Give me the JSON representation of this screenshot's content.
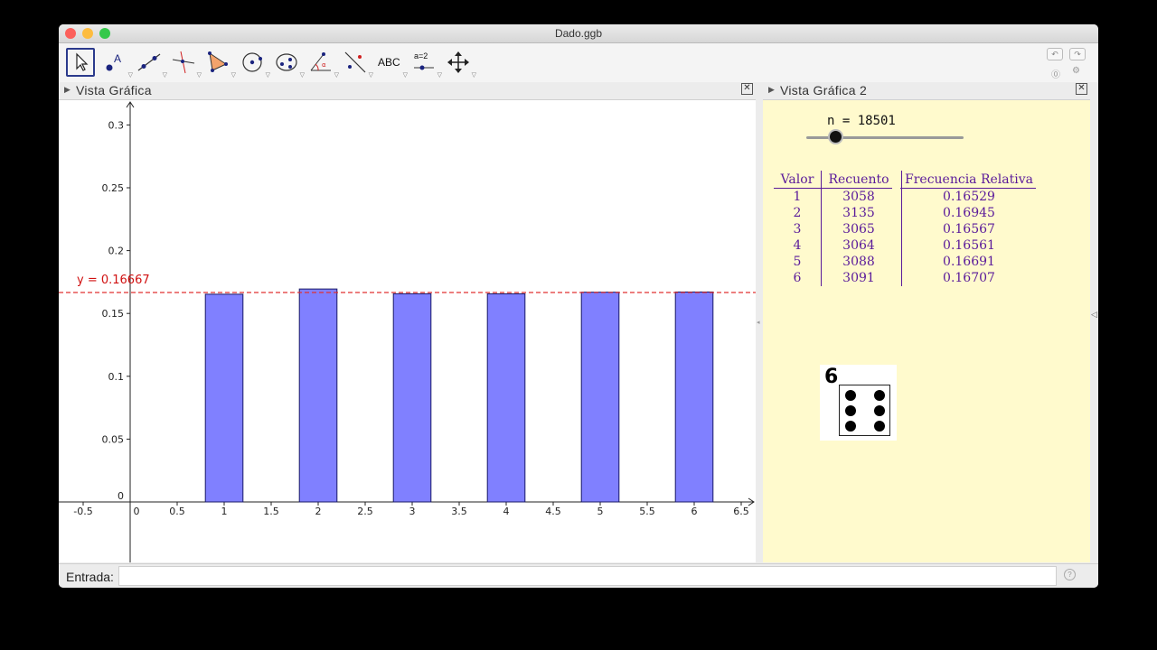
{
  "window": {
    "title": "Dado.ggb"
  },
  "toolbar": {
    "abc_label": "ABC",
    "slider_label": "a=2",
    "tools": [
      "move-tool-icon",
      "point-tool-icon",
      "line-tool-icon",
      "perpendicular-tool-icon",
      "polygon-tool-icon",
      "circle-tool-icon",
      "conic-tool-icon",
      "angle-tool-icon",
      "reflect-tool-icon",
      "text-tool-icon",
      "slider-tool-icon",
      "move-view-tool-icon"
    ]
  },
  "graphics1": {
    "title": "Vista Gráfica",
    "line_label": "y = 0.16667"
  },
  "graphics2": {
    "title": "Vista Gráfica 2",
    "n_label": "n = 18501",
    "slider_value": 18501,
    "table": {
      "headers": [
        "Valor",
        "Recuento",
        "Frecuencia Relativa"
      ],
      "rows": [
        [
          "1",
          "3058",
          "0.16529"
        ],
        [
          "2",
          "3135",
          "0.16945"
        ],
        [
          "3",
          "3065",
          "0.16567"
        ],
        [
          "4",
          "3064",
          "0.16561"
        ],
        [
          "5",
          "3088",
          "0.16691"
        ],
        [
          "6",
          "3091",
          "0.16707"
        ]
      ]
    },
    "die": {
      "value": "6",
      "pips": 6
    }
  },
  "input_bar": {
    "label": "Entrada:",
    "value": ""
  },
  "colors": {
    "bar_fill": "#8080ff",
    "bar_stroke": "#1a1a66",
    "expected_line": "#e03030",
    "graphics2_bg": "#fffacd",
    "table_text": "#5a1a9a"
  },
  "chart_data": {
    "type": "bar",
    "categories": [
      1,
      2,
      3,
      4,
      5,
      6
    ],
    "values": [
      0.16529,
      0.16945,
      0.16567,
      0.16561,
      0.16691,
      0.16707
    ],
    "bar_width": 0.4,
    "reference_line": {
      "y": 0.16667,
      "label": "y = 0.16667"
    },
    "xlim": [
      -0.7,
      6.6
    ],
    "ylim": [
      -0.05,
      0.31
    ],
    "x_ticks": [
      "-0.5",
      "0",
      "0.5",
      "1",
      "1.5",
      "2",
      "2.5",
      "3",
      "3.5",
      "4",
      "4.5",
      "5",
      "5.5",
      "6",
      "6.5"
    ],
    "y_ticks": [
      "0",
      "0.05",
      "0.1",
      "0.15",
      "0.2",
      "0.25",
      "0.3"
    ],
    "grid": false
  }
}
